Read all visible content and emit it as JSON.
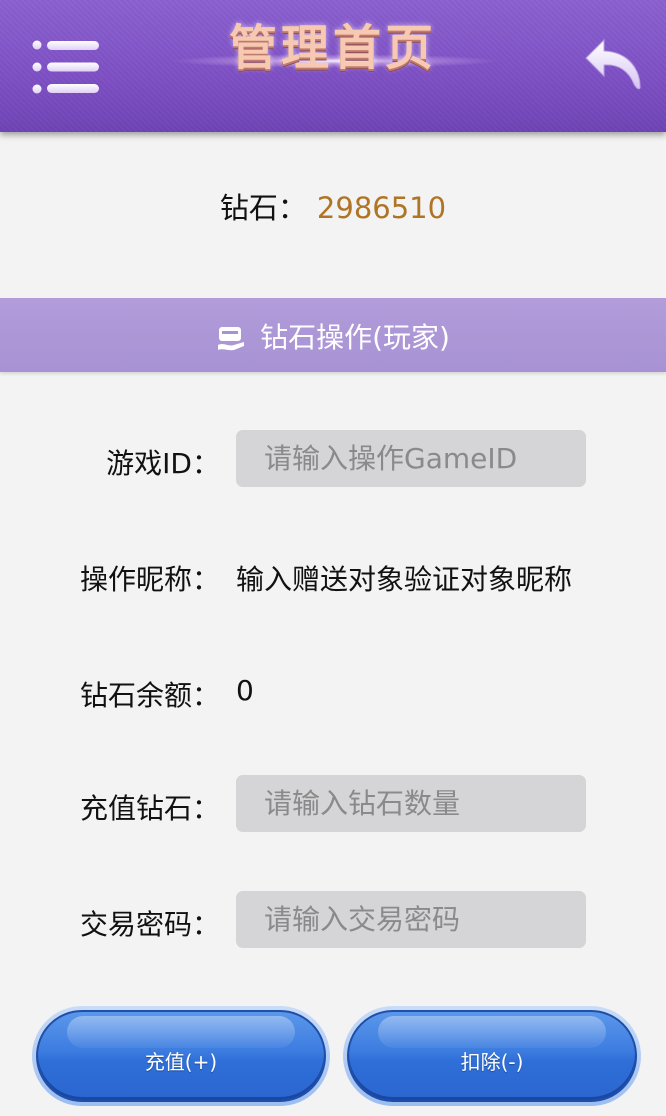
{
  "header": {
    "title": "管理首页",
    "menu_icon": "hamburger-menu-icon",
    "back_icon": "back-arrow-icon"
  },
  "balance": {
    "label": "钻石：",
    "value": "2986510"
  },
  "section": {
    "icon": "wallet-icon",
    "title": "钻石操作(玩家)"
  },
  "form": {
    "game_id": {
      "label": "游戏ID：",
      "placeholder": "请输入操作GameID",
      "value": ""
    },
    "nickname": {
      "label": "操作昵称：",
      "value": "输入赠送对象验证对象昵称"
    },
    "balance": {
      "label": "钻石余额：",
      "value": "0"
    },
    "recharge": {
      "label": "充值钻石：",
      "placeholder": "请输入钻石数量",
      "value": ""
    },
    "password": {
      "label": "交易密码：",
      "placeholder": "请输入交易密码",
      "value": ""
    }
  },
  "buttons": {
    "recharge": "充值(+)",
    "deduct": "扣除(-)"
  },
  "colors": {
    "header": "#7d4fc4",
    "section_bar": "#a792d4",
    "diamond_value": "#b07426",
    "button": "#2f6fd8",
    "input_bg": "#d5d5d7",
    "page_bg": "#f3f3f3"
  }
}
